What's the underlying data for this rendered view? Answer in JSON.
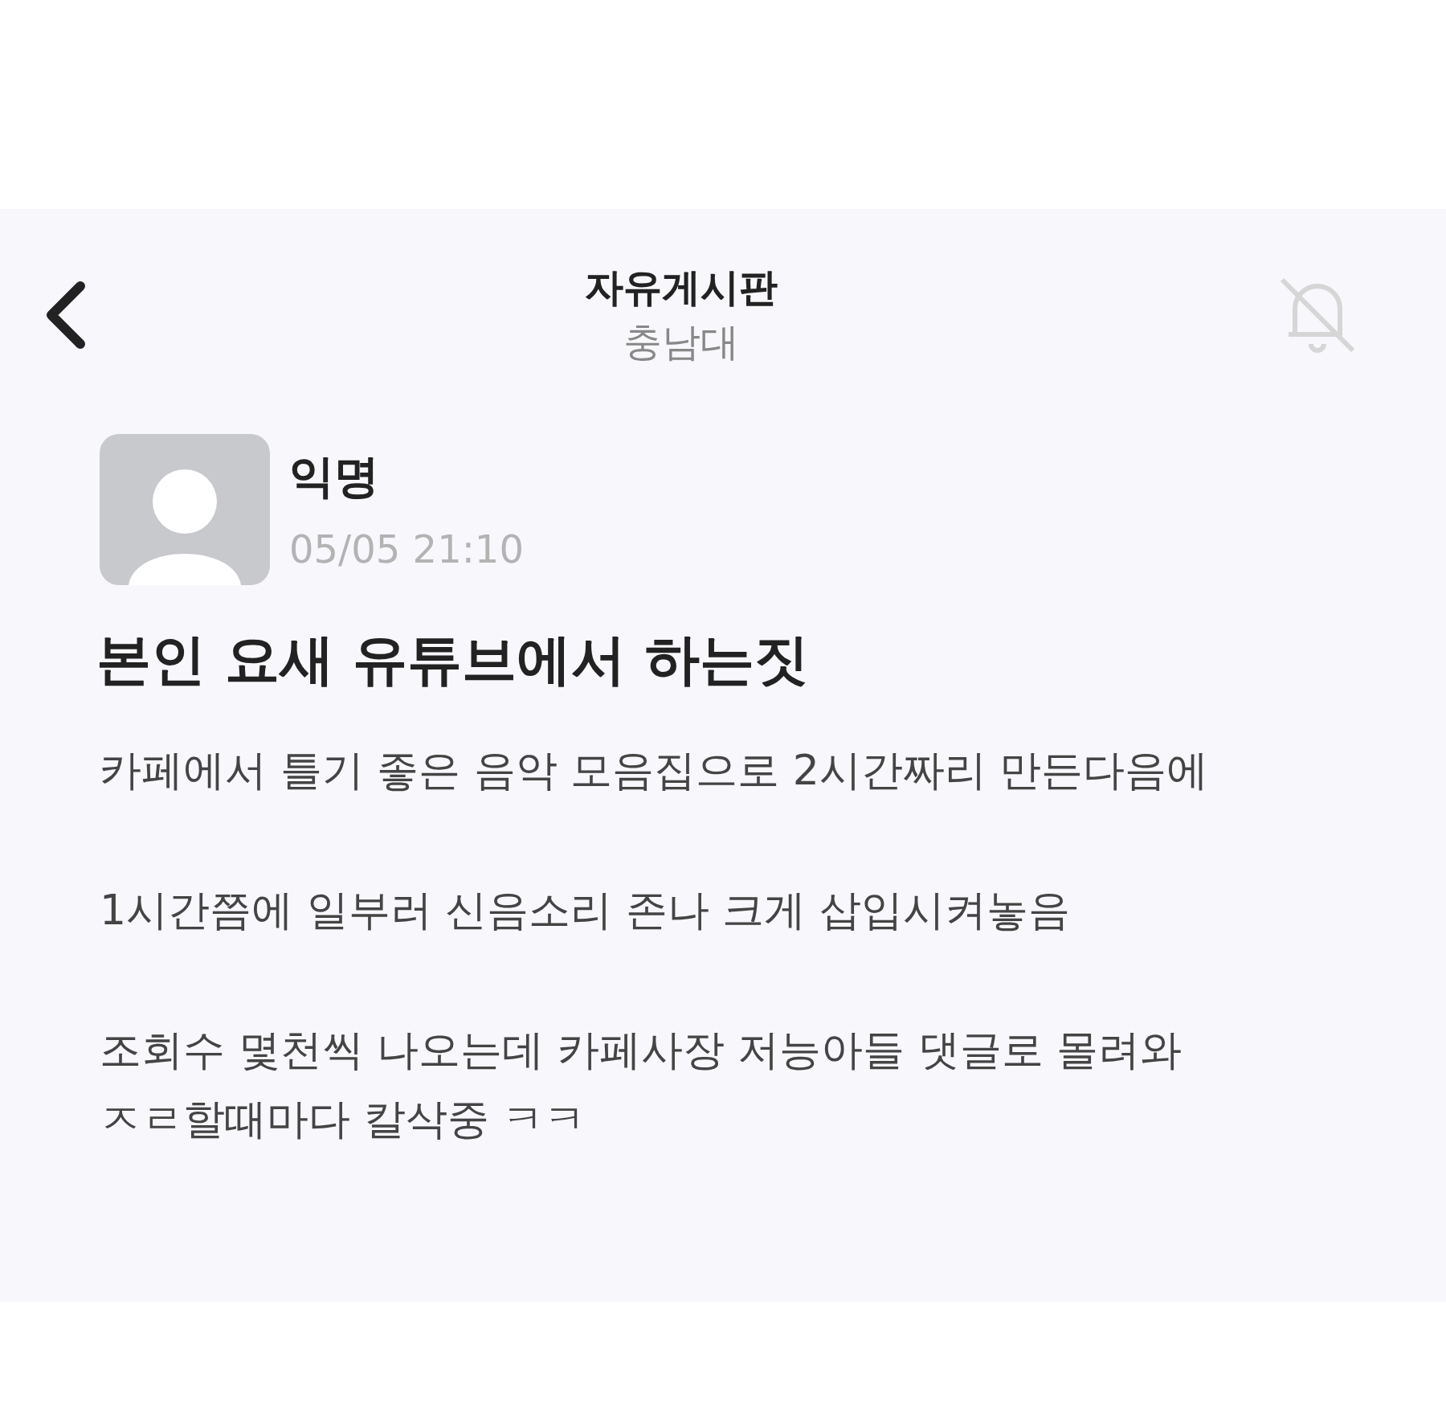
{
  "header": {
    "title": "자유게시판",
    "subtitle": "충남대",
    "notifications_on": false
  },
  "post": {
    "author": "익명",
    "time": "05/05 21:10",
    "title": "본인 요새 유튜브에서 하는짓",
    "paragraphs": [
      [
        "카페에서 틀기 좋은 음악 모음집으로 2시간짜리 만든다음에"
      ],
      [
        "1시간쯤에 일부러 신음소리 존나 크게 삽입시켜놓음"
      ],
      [
        "조회수 몇천씩 나오는데 카페사장 저능아들 댓글로 몰려와",
        "ㅈㄹ할때마다 칼삭중 ㅋㅋ"
      ]
    ]
  }
}
